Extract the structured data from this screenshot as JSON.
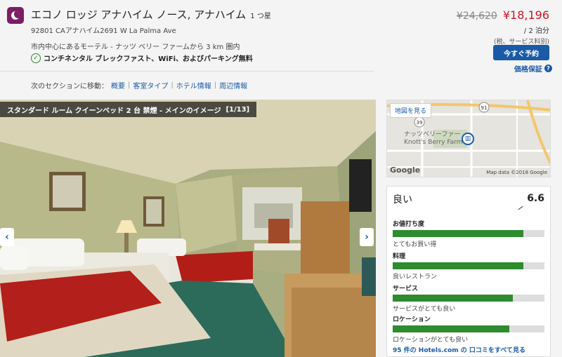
{
  "header": {
    "hotel_name": "エコノ ロッジ アナハイム ノース, アナハイム",
    "stars": "1 つ星",
    "address": "92801 CAアナハイム2691 W La Palma Ave",
    "location_note": "市内中心にあるモーテル - ナッツ ベリー ファームから 3 km 圏内",
    "amenities": "コンチネンタル ブレックファスト、WiFi、およびパーキング無料"
  },
  "section_nav": {
    "prefix": "次のセクションに移動：",
    "links": [
      "概要",
      "客室タイプ",
      "ホテル情報",
      "周辺情報"
    ],
    "separator": "|"
  },
  "price": {
    "old_price": "¥24,620",
    "new_price": "¥18,196",
    "nights": "/ 2 泊分",
    "tax_note": "(税、サービス料別)",
    "book_button": "今すぐ予約",
    "guarantee": "価格保証",
    "guarantee_icon": "?",
    "accent_color": "#d0132a",
    "brand_color": "#1a5aa6"
  },
  "photo": {
    "caption": "スタンダード ルーム クイーンベッド 2 台 禁煙 - メインのイメージ",
    "counter": "[1/13]",
    "prev_icon": "‹",
    "next_icon": "›"
  },
  "map": {
    "view_button": "地図を見る",
    "poi_label_1": "ナッツベリーファー",
    "poi_label_2": "Knott's Berry Farm",
    "highway_1": "91",
    "highway_2": "39",
    "google_label": "Google",
    "credit": "Map data ©2018 Google"
  },
  "ratings": {
    "overall_label": "良い",
    "overall_score": "6.6",
    "categories": [
      {
        "label": "お値打ち度",
        "description": "とてもお買い得",
        "fill": 0.86
      },
      {
        "label": "料理",
        "description": "良いレストラン",
        "fill": 0.86
      },
      {
        "label": "サービス",
        "description": "サービスがとても良い",
        "fill": 0.79
      },
      {
        "label": "ロケーション",
        "description": "ロケーションがとても良い",
        "fill": 0.77
      }
    ],
    "reviews_link": "95 件の Hotels.com の 口コミをすべて見る",
    "bar_color": "#2e8b2e"
  }
}
